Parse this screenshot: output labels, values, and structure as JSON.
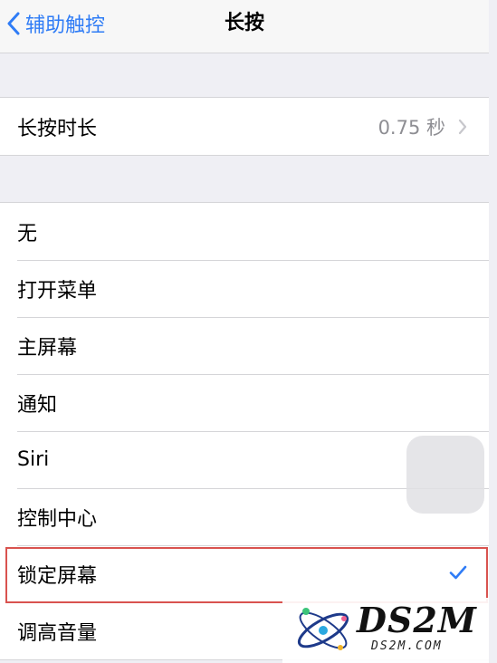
{
  "nav": {
    "back_label": "辅助触控",
    "title": "长按"
  },
  "duration_row": {
    "label": "长按时长",
    "value": "0.75 秒"
  },
  "actions": [
    {
      "label": "无",
      "selected": false
    },
    {
      "label": "打开菜单",
      "selected": false
    },
    {
      "label": "主屏幕",
      "selected": false
    },
    {
      "label": "通知",
      "selected": false
    },
    {
      "label": "Siri",
      "selected": false
    },
    {
      "label": "控制中心",
      "selected": false
    },
    {
      "label": "锁定屏幕",
      "selected": true
    },
    {
      "label": "调高音量",
      "selected": false
    }
  ],
  "watermark": {
    "title": "DS2M",
    "subtitle": "DS2M.COM"
  },
  "colors": {
    "accent": "#2f7cf6",
    "highlight_border": "#d9534f",
    "background": "#efeff4"
  }
}
